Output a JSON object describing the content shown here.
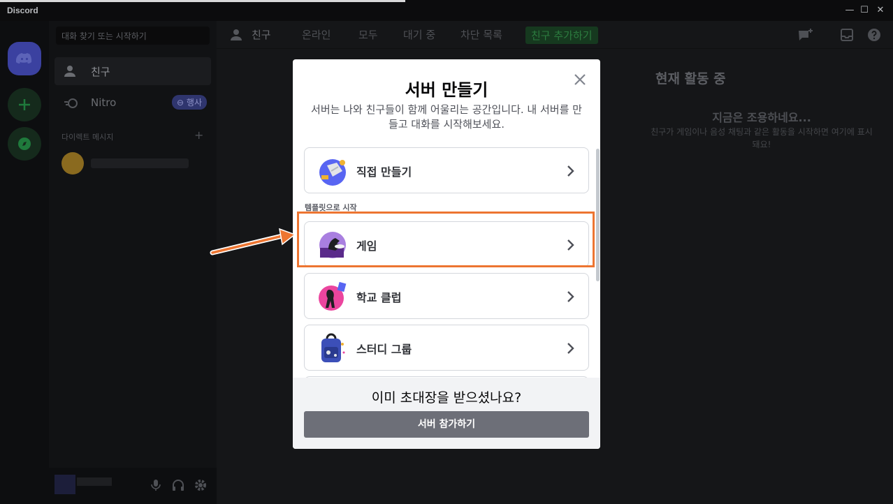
{
  "window": {
    "app_name": "Discord",
    "controls": {
      "minimize": "—",
      "maximize": "☐",
      "close": "✕"
    }
  },
  "sidebar": {
    "search_placeholder": "대화 찾기 또는 시작하기",
    "friends_label": "친구",
    "nitro_label": "Nitro",
    "nitro_badge": "⊖ 행사",
    "dm_header": "다이렉트 메시지",
    "dm_add": "+"
  },
  "topbar": {
    "title": "친구",
    "tabs": [
      "온라인",
      "모두",
      "대기 중",
      "차단 목록"
    ],
    "add_friend": "친구 추가하기"
  },
  "activity": {
    "title": "현재 활동 중",
    "empty_title": "지금은 조용하네요...",
    "empty_desc": "친구가 게임이나 음성 채팅과 같은 활동을 시작하면 여기에 표시돼요!"
  },
  "modal": {
    "title": "서버 만들기",
    "description": "서버는 나와 친구들이 함께 어울리는 공간입니다. 내 서버를 만들고 대화를 시작해보세요.",
    "close_icon": "close-icon",
    "create_own": "직접 만들기",
    "template_section": "템플릿으로 시작",
    "templates": [
      "게임",
      "학교 클럽",
      "스터디 그룹"
    ],
    "footer_question": "이미 초대장을 받으셨나요?",
    "join_button": "서버 참가하기"
  },
  "annotation": {
    "highlight_color": "#ed7531",
    "highlighted_option": "게임"
  }
}
